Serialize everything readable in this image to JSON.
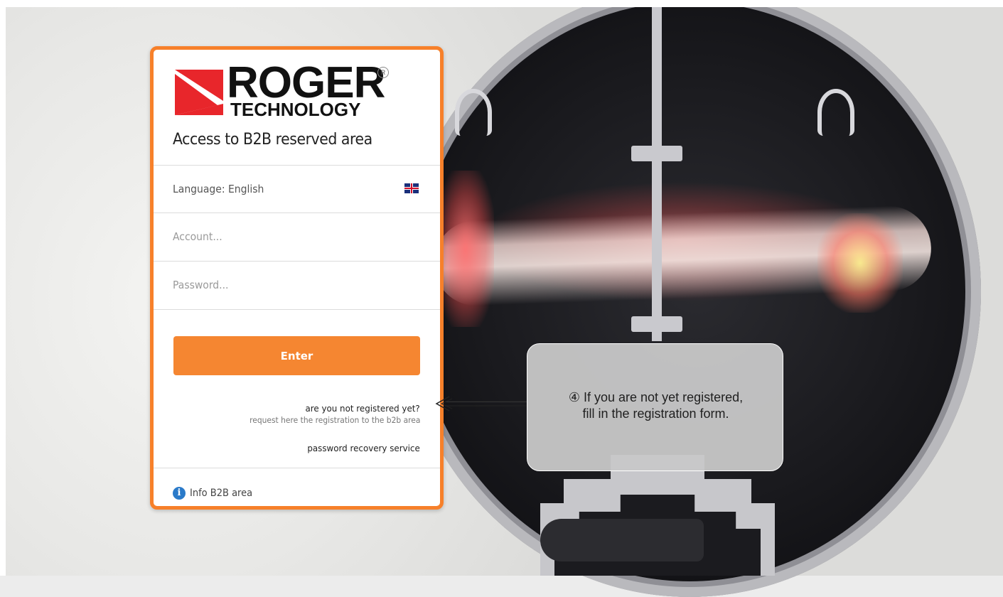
{
  "brand": {
    "name": "ROGER",
    "subtitle": "TECHNOLOGY",
    "registered_mark": "R",
    "accent_color": "#f58631"
  },
  "login": {
    "title": "Access to B2B reserved area",
    "language_label": "Language: English",
    "language_flag": "uk-flag-icon",
    "account_placeholder": "Account...",
    "password_placeholder": "Password...",
    "enter_label": "Enter",
    "register_question": "are you not registered yet?",
    "register_link": "request here the registration to the b2b area",
    "password_recovery": "password recovery service",
    "info_label": "Info B2B area",
    "info_icon": "info-icon"
  },
  "callout": {
    "line1": "④ If you are not yet registered,",
    "line2": "fill in the registration form."
  }
}
